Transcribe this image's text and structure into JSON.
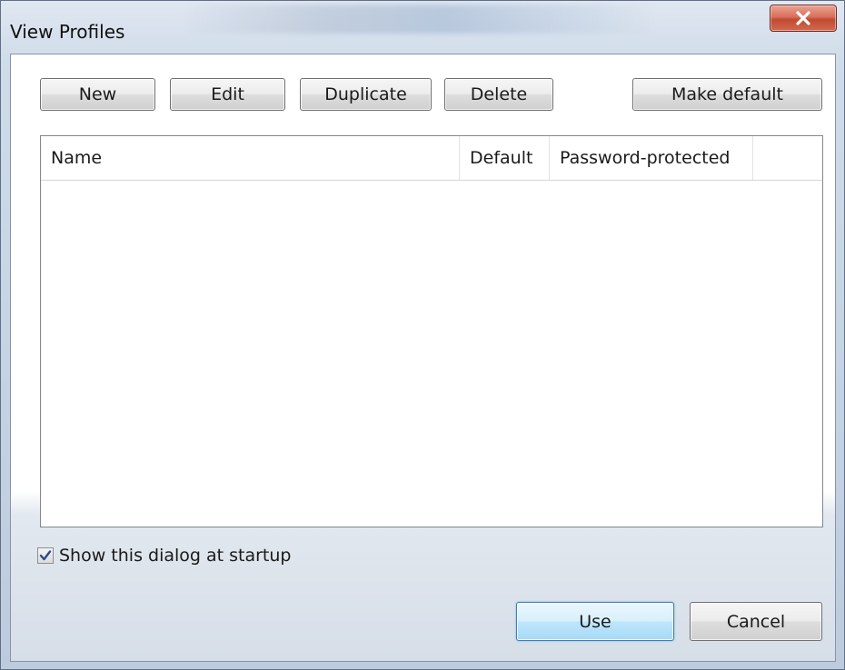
{
  "window": {
    "title": "View Profiles"
  },
  "toolbar": {
    "new_label": "New",
    "edit_label": "Edit",
    "duplicate_label": "Duplicate",
    "delete_label": "Delete",
    "make_default_label": "Make default"
  },
  "list": {
    "columns": [
      "Name",
      "Default",
      "Password-protected"
    ],
    "rows": []
  },
  "startup_checkbox": {
    "label": "Show this dialog at startup",
    "checked": true
  },
  "footer": {
    "use_label": "Use",
    "cancel_label": "Cancel"
  },
  "icons": {
    "close": "close-icon",
    "check": "checkmark-icon"
  }
}
